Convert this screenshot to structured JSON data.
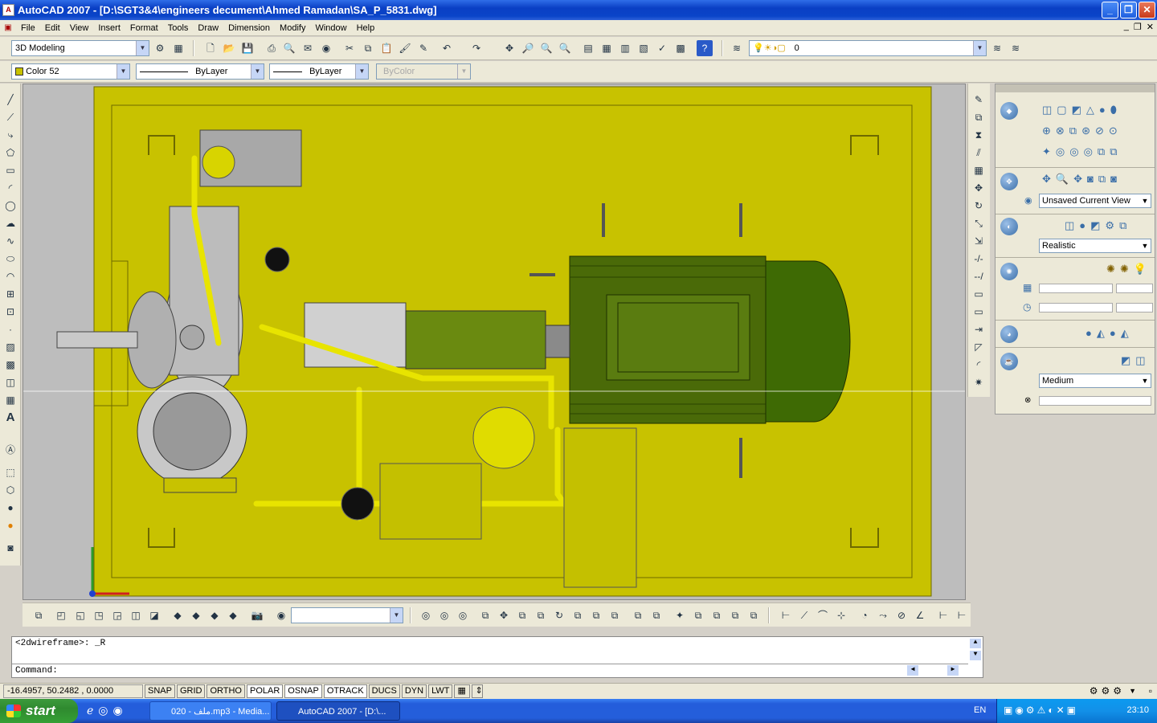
{
  "window": {
    "title": "AutoCAD 2007 - [D:\\SGT3&4\\engineers decument\\Ahmed Ramadan\\SA_P_5831.dwg]",
    "minimize_label": "_",
    "maximize_label": "❐",
    "close_label": "✕"
  },
  "menu": [
    "File",
    "Edit",
    "View",
    "Insert",
    "Format",
    "Tools",
    "Draw",
    "Dimension",
    "Modify",
    "Window",
    "Help"
  ],
  "workspace": {
    "value": "3D Modeling"
  },
  "layer": {
    "value": "0"
  },
  "properties": {
    "color": "Color 52",
    "linetype": "ByLayer",
    "lineweight": "ByLayer",
    "plotstyle": "ByColor"
  },
  "dashboard": {
    "view": "Unsaved Current View",
    "visual_style": "Realistic",
    "render_preset": "Medium"
  },
  "command": {
    "history": "<2dwireframe>: _R",
    "prompt": "Command:"
  },
  "status": {
    "coords": "-16.4957, 50.2482 , 0.0000",
    "buttons": [
      "SNAP",
      "GRID",
      "ORTHO",
      "POLAR",
      "OSNAP",
      "OTRACK",
      "DUCS",
      "DYN",
      "LWT"
    ]
  },
  "taskbar": {
    "start": "start",
    "items": [
      "020 - ملف.mp3 - Media...",
      "AutoCAD 2007 - [D:\\..."
    ],
    "lang": "EN",
    "clock": "23:10"
  },
  "colors": {
    "drawing_bg": "#c8c200",
    "titlebar": "#0a44c8"
  }
}
